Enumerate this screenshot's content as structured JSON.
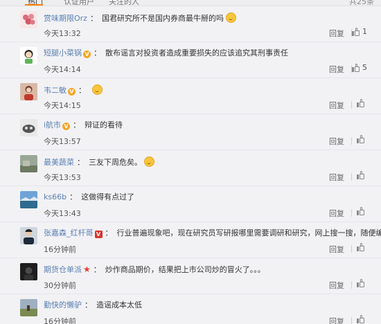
{
  "header": {
    "tabs": [
      {
        "label": "热门"
      },
      {
        "label": "认证用户"
      },
      {
        "label": "关注的人"
      }
    ],
    "total": "共25条"
  },
  "comments": [
    {
      "user": "赏味期限Orz",
      "badge": "",
      "text": "国君研究所不是国内券商最牛掰的吗",
      "emoji": true,
      "time": "今天13:32",
      "reply": "回复",
      "likes": "1"
    },
    {
      "user": "短腿小菜锅",
      "badge": "V",
      "text": "散布谣言对投资者造成重要损失的应该追究其刑事责任",
      "emoji": false,
      "time": "今天14:14",
      "reply": "回复",
      "likes": "5"
    },
    {
      "user": "韦二敏",
      "badge": "V",
      "text": "",
      "emoji": true,
      "time": "今天14:15",
      "reply": "回复",
      "likes": ""
    },
    {
      "user": "i航市",
      "badge": "V",
      "text": "辩证的看待",
      "emoji": false,
      "time": "今天13:57",
      "reply": "回复",
      "likes": ""
    },
    {
      "user": "最美蔬菜",
      "badge": "",
      "text": "三友下周危矣。",
      "emoji": true,
      "time": "今天13:53",
      "reply": "回复",
      "likes": ""
    },
    {
      "user": "ks66b",
      "badge": "",
      "text": "这做得有点过了",
      "emoji": false,
      "time": "今天13:43",
      "reply": "回复",
      "likes": ""
    },
    {
      "user": "张嘉森_红杆哥",
      "badge": "V",
      "text": "行业普遍现象吧，现在研究员写研报哪里需要调研和研究，网上搜一搜，随便编!",
      "emoji": false,
      "time": "16分钟前",
      "reply": "回复",
      "likes": ""
    },
    {
      "user": "期货仓单派",
      "badge": "★",
      "text": "炒作商品期价，结果把上市公司炒的冒火了。。。",
      "emoji": false,
      "time": "30分钟前",
      "reply": "回复",
      "likes": ""
    },
    {
      "user": "勤快的懒驴",
      "badge": "",
      "text": "造谣成本太低",
      "emoji": false,
      "time": "16分钟前",
      "reply": "回复",
      "likes": ""
    }
  ],
  "colors": {
    "username": "#5a80b2",
    "accent": "#ff8200",
    "vip_badge": "#f5a623"
  },
  "icons": {
    "like": "thumbs-up-icon",
    "emoji": "smiley-emoji-icon"
  }
}
